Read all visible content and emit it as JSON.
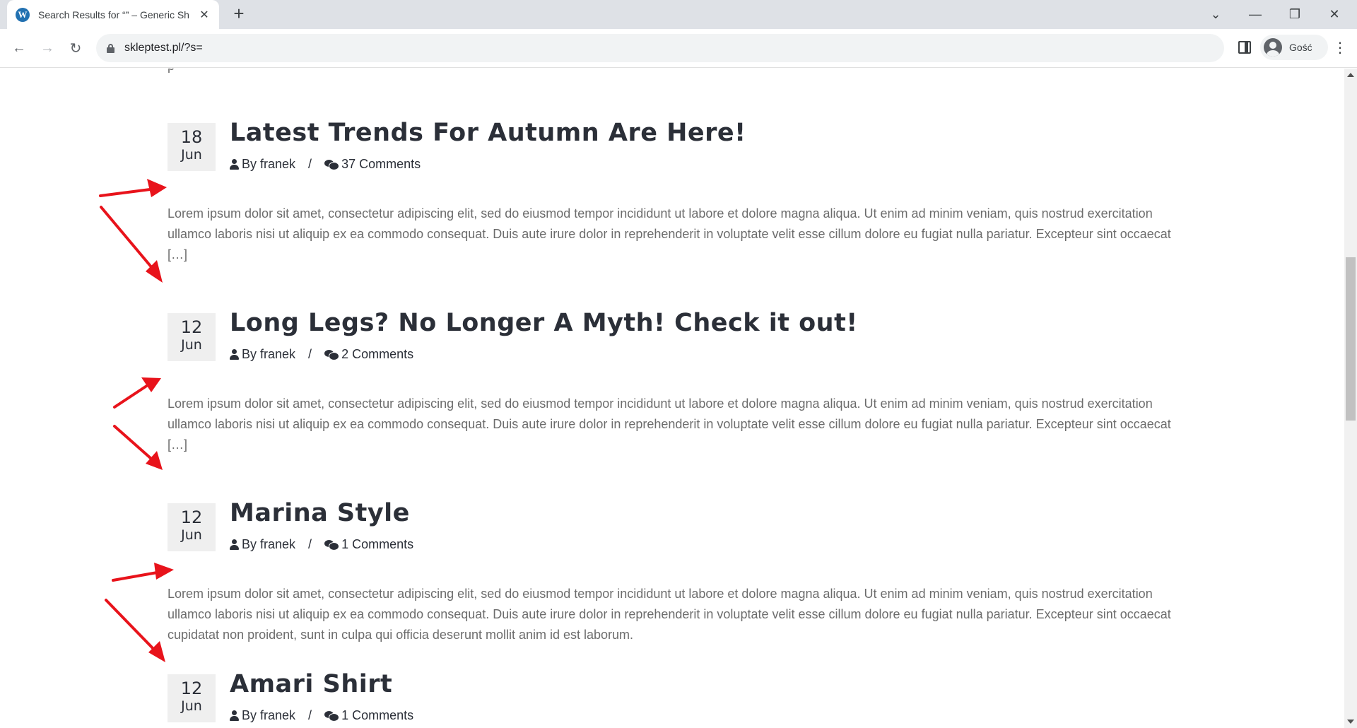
{
  "browser": {
    "tab_title": "Search Results for “” – Generic Sh",
    "url": "skleptest.pl/?s=",
    "profile_name": "Gość",
    "tab_icon": "wordpress-icon"
  },
  "page": {
    "cut_text": "p                              ",
    "posts": [
      {
        "day": "18",
        "month": "Jun",
        "title": "Latest Trends For Autumn Are Here!",
        "author": "By franek",
        "separator": "/",
        "comments": "37 Comments",
        "excerpt": "Lorem ipsum dolor sit amet, consectetur adipiscing elit, sed do eiusmod tempor incididunt ut labore et dolore magna aliqua. Ut enim ad minim veniam, quis nostrud exercitation ullamco laboris nisi ut aliquip ex ea commodo consequat. Duis aute irure dolor in reprehenderit in voluptate velit esse cillum dolore eu fugiat nulla pariatur. Excepteur sint occaecat",
        "more": "[…]"
      },
      {
        "day": "12",
        "month": "Jun",
        "title": "Long Legs? No Longer A Myth! Check it out!",
        "author": "By franek",
        "separator": "/",
        "comments": "2 Comments",
        "excerpt": "Lorem ipsum dolor sit amet, consectetur adipiscing elit, sed do eiusmod tempor incididunt ut labore et dolore magna aliqua. Ut enim ad minim veniam, quis nostrud exercitation ullamco laboris nisi ut aliquip ex ea commodo consequat. Duis aute irure dolor in reprehenderit in voluptate velit esse cillum dolore eu fugiat nulla pariatur. Excepteur sint occaecat",
        "more": "[…]"
      },
      {
        "day": "12",
        "month": "Jun",
        "title": "Marina Style",
        "author": "By franek",
        "separator": "/",
        "comments": "1 Comments",
        "excerpt": "Lorem ipsum dolor sit amet, consectetur adipiscing elit, sed do eiusmod tempor incididunt ut labore et dolore magna aliqua. Ut enim ad minim veniam, quis nostrud exercitation ullamco laboris nisi ut aliquip ex ea commodo consequat. Duis aute irure dolor in reprehenderit in voluptate velit esse cillum dolore eu fugiat nulla pariatur. Excepteur sint occaecat cupidatat non proident, sunt in culpa qui officia deserunt mollit anim id est laborum.",
        "more": ""
      },
      {
        "day": "12",
        "month": "Jun",
        "title": "Amari Shirt",
        "author": "By franek",
        "separator": "/",
        "comments": "1 Comments",
        "excerpt": "",
        "more": ""
      }
    ]
  },
  "annotation_color": "#e8131b"
}
